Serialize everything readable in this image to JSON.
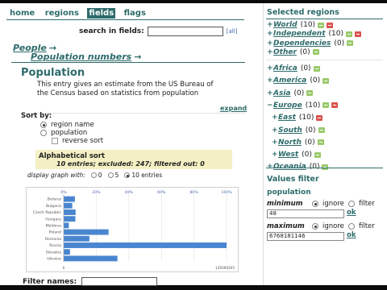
{
  "nav": {
    "home": "home",
    "regions": "regions",
    "fields": "fields",
    "flags": "flags"
  },
  "search": {
    "label": "search in fields:",
    "value": "",
    "all": "[all]"
  },
  "breadcrumb": {
    "people": "People",
    "population_numbers": "Population numbers",
    "arrow": "→"
  },
  "entry": {
    "title": "Population",
    "description": "This entry gives an estimate from the US Bureau of the Census based on statistics from population",
    "expand": "expand"
  },
  "sort": {
    "label": "Sort by:",
    "options": [
      "region name",
      "population"
    ],
    "selected": "region name",
    "reverse": "reverse sort"
  },
  "sortbox": {
    "heading": "Alphabetical sort",
    "summary": "10 entries; excluded: 247; filtered out: 0"
  },
  "display_graph": {
    "label": "display graph with:",
    "options": [
      "0",
      "5",
      "10 entries"
    ],
    "selected": "10 entries"
  },
  "chart_data": {
    "type": "bar",
    "orientation": "horizontal",
    "categories": [
      "Belarus",
      "Bulgaria",
      "Czech Republic",
      "Hungary",
      "Moldova",
      "Poland",
      "Romania",
      "Russia",
      "Slovakia",
      "Ukraine"
    ],
    "values": [
      9600000,
      7300000,
      10200000,
      10000000,
      4400000,
      38400000,
      22000000,
      142000000,
      5400000,
      46000000
    ],
    "x_ticks": [
      "0%",
      "20%",
      "40%",
      "60%",
      "80%",
      "100%"
    ],
    "x_max_label": "139390205",
    "xlim": [
      0,
      139390205
    ],
    "grid": true,
    "color": "#4a86d0"
  },
  "filter_names": {
    "label": "Filter names:",
    "value": ""
  },
  "right": {
    "selected_regions": "Selected regions",
    "top": [
      {
        "name": "World",
        "count": "(10)",
        "pm": "+",
        "icons": [
          "g",
          "r"
        ]
      },
      {
        "name": "Independent",
        "count": "(10)",
        "pm": "+",
        "icons": [
          "g",
          "r"
        ]
      },
      {
        "name": "Dependencies",
        "count": "(0)",
        "pm": "+",
        "icons": [
          "g"
        ]
      },
      {
        "name": "Other",
        "count": "(0)",
        "pm": "+",
        "icons": [
          "g"
        ]
      }
    ],
    "continents": [
      {
        "name": "Africa",
        "count": "(0)",
        "pm": "+",
        "icons": [
          "g"
        ]
      },
      {
        "name": "America",
        "count": "(0)",
        "pm": "+",
        "icons": [
          "g"
        ]
      },
      {
        "name": "Asia",
        "count": "(0)",
        "pm": "+",
        "icons": [
          "g"
        ]
      },
      {
        "name": "Europe",
        "count": "(10)",
        "pm": "−",
        "icons": [
          "g",
          "r"
        ]
      },
      {
        "name": "East",
        "count": "(10)",
        "pm": "+",
        "icons": [
          "r"
        ],
        "indent": true
      },
      {
        "name": "South",
        "count": "(0)",
        "pm": "+",
        "icons": [
          "g"
        ],
        "indent": true
      },
      {
        "name": "North",
        "count": "(0)",
        "pm": "+",
        "icons": [
          "g"
        ],
        "indent": true
      },
      {
        "name": "West",
        "count": "(0)",
        "pm": "+",
        "icons": [
          "g"
        ],
        "indent": true
      },
      {
        "name": "Oceania",
        "count": "(0)",
        "pm": "+",
        "icons": [
          "g"
        ]
      }
    ],
    "values_filter": "Values filter",
    "population": "population",
    "minimum": {
      "label": "minimum",
      "ignore": "ignore",
      "filter": "filter",
      "value": "48",
      "ok": "ok"
    },
    "maximum": {
      "label": "maximum",
      "ignore": "ignore",
      "filter": "filter",
      "value": "6768181146",
      "ok": "ok"
    }
  }
}
